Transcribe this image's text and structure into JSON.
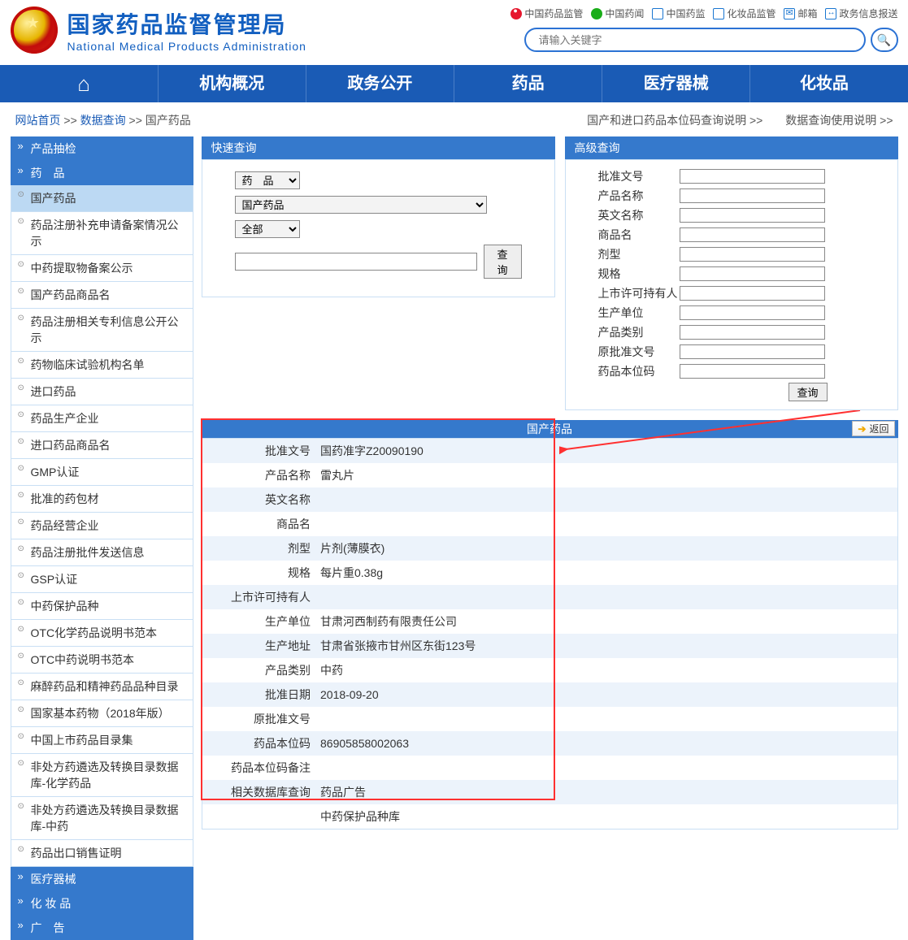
{
  "header": {
    "title_cn": "国家药品监督管理局",
    "title_en": "National Medical Products Administration",
    "links": [
      {
        "icon": "weibo",
        "text": "中国药品监管"
      },
      {
        "icon": "wechat",
        "text": "中国药闻"
      },
      {
        "icon": "app",
        "text": "中国药监"
      },
      {
        "icon": "app",
        "text": "化妆品监管"
      },
      {
        "icon": "mail",
        "text": "邮箱"
      },
      {
        "icon": "phone",
        "text": "政务信息报送"
      }
    ],
    "search_placeholder": "请输入关键字"
  },
  "nav": [
    "",
    "机构概况",
    "政务公开",
    "药品",
    "医疗器械",
    "化妆品"
  ],
  "breadcrumb": {
    "home": "网站首页",
    "sep": ">>",
    "mid": "数据查询",
    "cur": "国产药品",
    "right1": "国产和进口药品本位码查询说明 >>",
    "right2": "数据查询使用说明 >>"
  },
  "sidebar": {
    "groups": [
      {
        "title": "产品抽检",
        "items": []
      },
      {
        "title": "药　品",
        "items": [
          {
            "label": "国产药品",
            "active": true
          },
          {
            "label": "药品注册补充申请备案情况公示"
          },
          {
            "label": "中药提取物备案公示"
          },
          {
            "label": "国产药品商品名"
          },
          {
            "label": "药品注册相关专利信息公开公示"
          },
          {
            "label": "药物临床试验机构名单"
          },
          {
            "label": "进口药品"
          },
          {
            "label": "药品生产企业"
          },
          {
            "label": "进口药品商品名"
          },
          {
            "label": "GMP认证"
          },
          {
            "label": "批准的药包材"
          },
          {
            "label": "药品经营企业"
          },
          {
            "label": "药品注册批件发送信息"
          },
          {
            "label": "GSP认证"
          },
          {
            "label": "中药保护品种"
          },
          {
            "label": "OTC化学药品说明书范本"
          },
          {
            "label": "OTC中药说明书范本"
          },
          {
            "label": "麻醉药品和精神药品品种目录"
          },
          {
            "label": "国家基本药物（2018年版）"
          },
          {
            "label": "中国上市药品目录集"
          },
          {
            "label": "非处方药遴选及转换目录数据库-化学药品"
          },
          {
            "label": "非处方药遴选及转换目录数据库-中药"
          },
          {
            "label": "药品出口销售证明"
          }
        ]
      },
      {
        "title": "医疗器械",
        "items": []
      },
      {
        "title": "化 妆 品",
        "items": []
      },
      {
        "title": "广　告",
        "items": []
      }
    ]
  },
  "quick_search": {
    "title": "快速查询",
    "sel1": "药　品",
    "sel2": "国产药品",
    "sel3": "全部",
    "btn": "查询"
  },
  "adv_search": {
    "title": "高级查询",
    "fields": [
      "批准文号",
      "产品名称",
      "英文名称",
      "商品名",
      "剂型",
      "规格",
      "上市许可持有人",
      "生产单位",
      "产品类别",
      "原批准文号",
      "药品本位码"
    ],
    "btn": "查询"
  },
  "result": {
    "title": "国产药品",
    "back": "返回",
    "rows": [
      {
        "label": "批准文号",
        "value": "国药准字Z20090190"
      },
      {
        "label": "产品名称",
        "value": "雷丸片"
      },
      {
        "label": "英文名称",
        "value": ""
      },
      {
        "label": "商品名",
        "value": ""
      },
      {
        "label": "剂型",
        "value": "片剂(薄膜衣)"
      },
      {
        "label": "规格",
        "value": "每片重0.38g"
      },
      {
        "label": "上市许可持有人",
        "value": ""
      },
      {
        "label": "生产单位",
        "value": "甘肃河西制药有限责任公司"
      },
      {
        "label": "生产地址",
        "value": "甘肃省张掖市甘州区东街123号"
      },
      {
        "label": "产品类别",
        "value": "中药"
      },
      {
        "label": "批准日期",
        "value": "2018-09-20"
      },
      {
        "label": "原批准文号",
        "value": ""
      },
      {
        "label": "药品本位码",
        "value": "86905858002063"
      },
      {
        "label": "药品本位码备注",
        "value": ""
      },
      {
        "label": "相关数据库查询",
        "value": "药品广告"
      },
      {
        "label": "",
        "value": "中药保护品种库"
      }
    ]
  }
}
